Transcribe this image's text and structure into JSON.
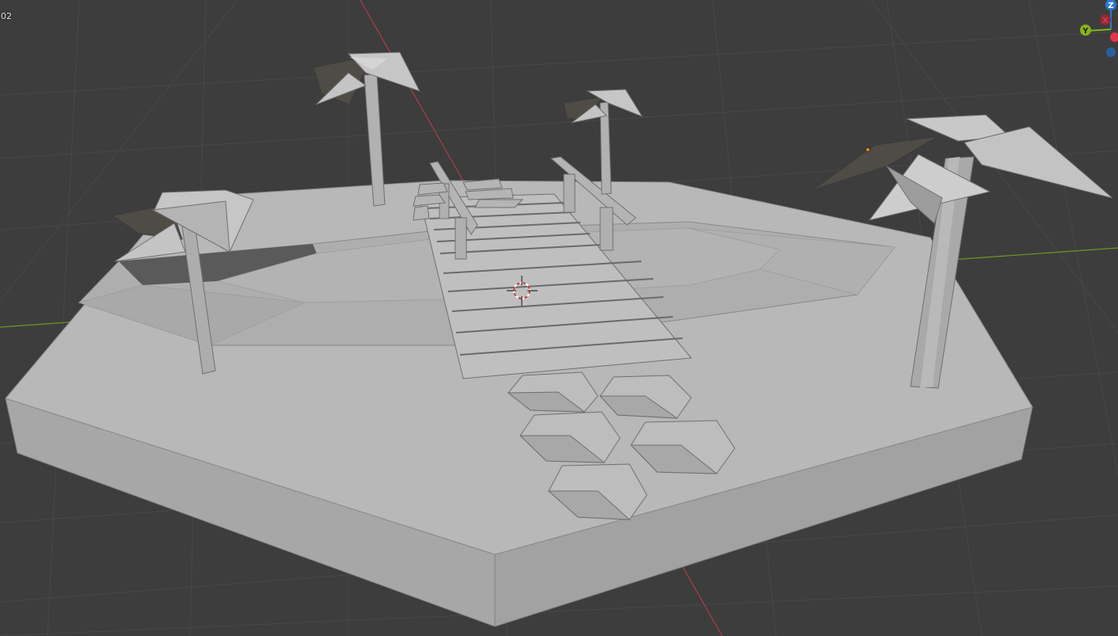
{
  "viewport": {
    "frame_label": "02",
    "background_color": "#3d3d3d",
    "grid_line_color": "#484848",
    "x_axis_color": "#b23a48",
    "y_axis_color": "#6e9a21"
  },
  "gizmo": {
    "z_label": "Z",
    "x_label": "X",
    "y_label": "Y",
    "z_color": "#2b7bd6",
    "x_color": "#e0354e",
    "y_color": "#86b31c",
    "neg_z_color": "#2a5f9e"
  },
  "scene": {
    "model_color": "#bdbdbd",
    "shadow_color": "#8c8c8c",
    "dark_leaf_color": "#4f4b45",
    "cursor_colors": [
      "#c93636",
      "#ffffff"
    ]
  }
}
